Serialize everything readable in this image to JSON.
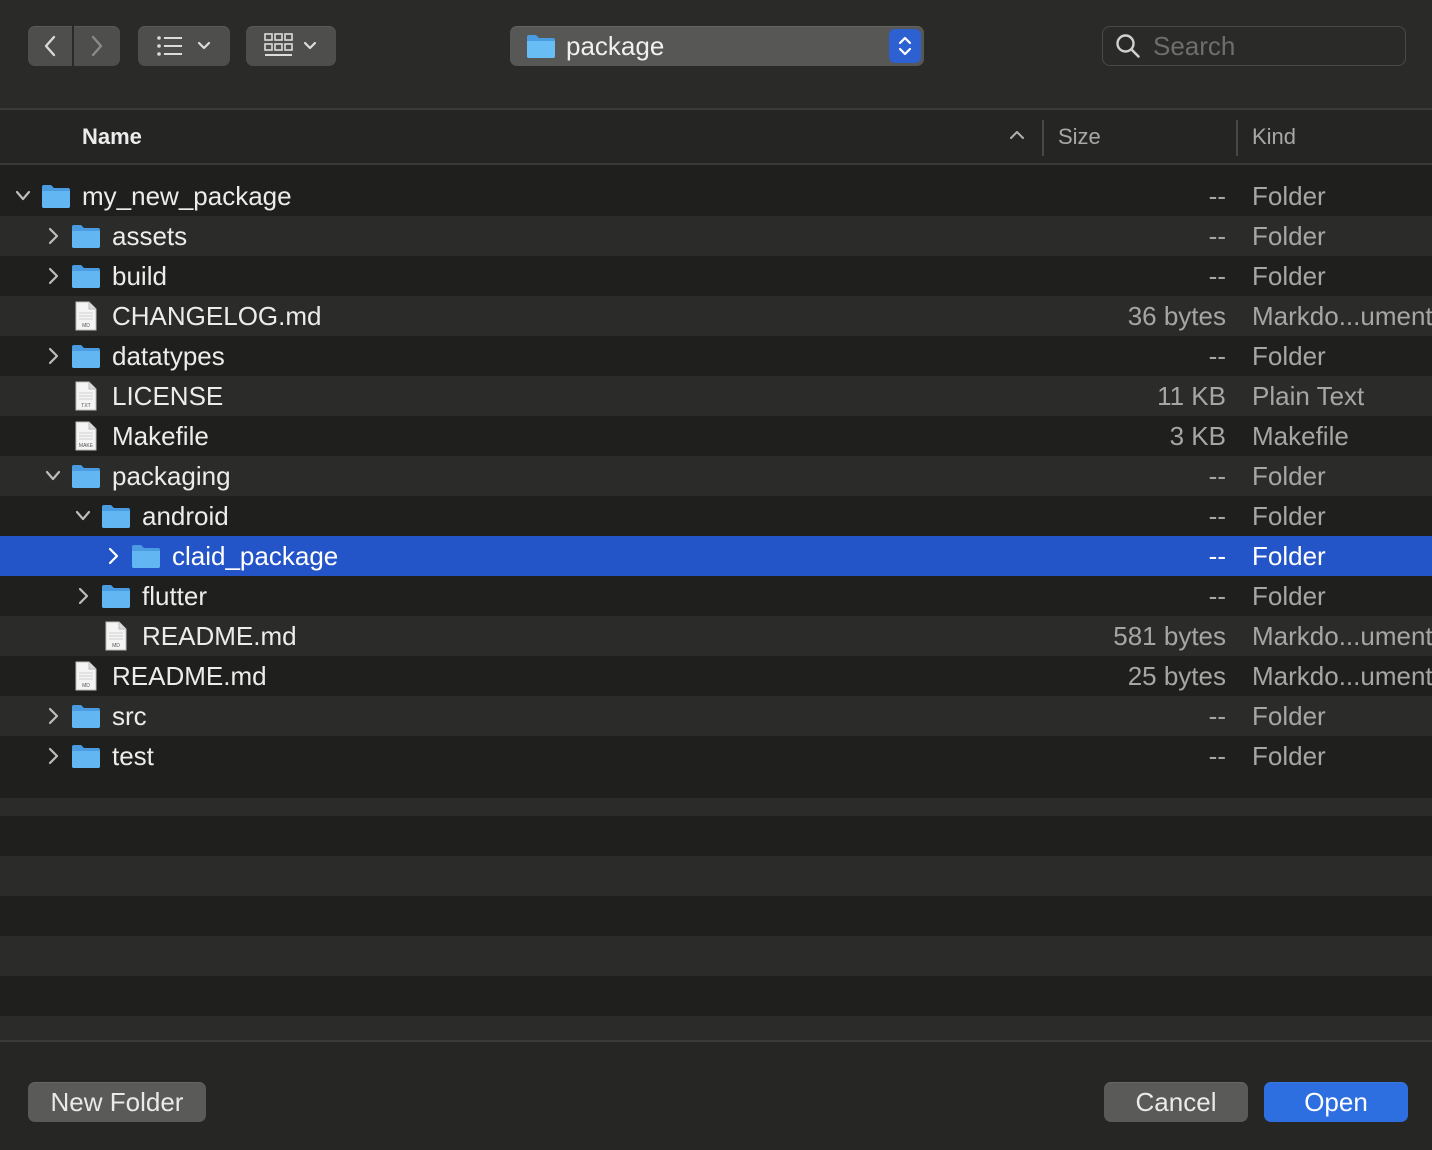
{
  "toolbar": {
    "back": "chevron-left",
    "forward": "chevron-right",
    "view_list": "list-view",
    "view_grid": "grid-view",
    "path": "package",
    "search_placeholder": "Search"
  },
  "columns": {
    "name": "Name",
    "size": "Size",
    "kind": "Kind"
  },
  "rows": [
    {
      "name": "my_new_package",
      "size": "--",
      "kind": "Folder",
      "type": "folder",
      "depth": 0,
      "expand": "open"
    },
    {
      "name": "assets",
      "size": "--",
      "kind": "Folder",
      "type": "folder",
      "depth": 1,
      "expand": "closed"
    },
    {
      "name": "build",
      "size": "--",
      "kind": "Folder",
      "type": "folder",
      "depth": 1,
      "expand": "closed"
    },
    {
      "name": "CHANGELOG.md",
      "size": "36 bytes",
      "kind": "Markdo...ument",
      "type": "file",
      "badge": "MD",
      "depth": 1
    },
    {
      "name": "datatypes",
      "size": "--",
      "kind": "Folder",
      "type": "folder",
      "depth": 1,
      "expand": "closed"
    },
    {
      "name": "LICENSE",
      "size": "11 KB",
      "kind": "Plain Text",
      "type": "file",
      "badge": "TXT",
      "depth": 1
    },
    {
      "name": "Makefile",
      "size": "3 KB",
      "kind": "Makefile",
      "type": "file",
      "badge": "MAKE",
      "depth": 1
    },
    {
      "name": "packaging",
      "size": "--",
      "kind": "Folder",
      "type": "folder",
      "depth": 1,
      "expand": "open"
    },
    {
      "name": "android",
      "size": "--",
      "kind": "Folder",
      "type": "folder",
      "depth": 2,
      "expand": "open"
    },
    {
      "name": "claid_package",
      "size": "--",
      "kind": "Folder",
      "type": "folder",
      "depth": 3,
      "expand": "closed",
      "selected": true
    },
    {
      "name": "flutter",
      "size": "--",
      "kind": "Folder",
      "type": "folder",
      "depth": 2,
      "expand": "closed"
    },
    {
      "name": "README.md",
      "size": "581 bytes",
      "kind": "Markdo...ument",
      "type": "file",
      "badge": "MD",
      "depth": 2
    },
    {
      "name": "README.md",
      "size": "25 bytes",
      "kind": "Markdo...ument",
      "type": "file",
      "badge": "MD",
      "depth": 1
    },
    {
      "name": "src",
      "size": "--",
      "kind": "Folder",
      "type": "folder",
      "depth": 1,
      "expand": "closed"
    },
    {
      "name": "test",
      "size": "--",
      "kind": "Folder",
      "type": "folder",
      "depth": 1,
      "expand": "closed"
    }
  ],
  "buttons": {
    "new_folder": "New Folder",
    "cancel": "Cancel",
    "open": "Open"
  },
  "colors": {
    "accent": "#2d6ee0",
    "selection": "#2354c8",
    "folder": "#5ab0ef"
  }
}
